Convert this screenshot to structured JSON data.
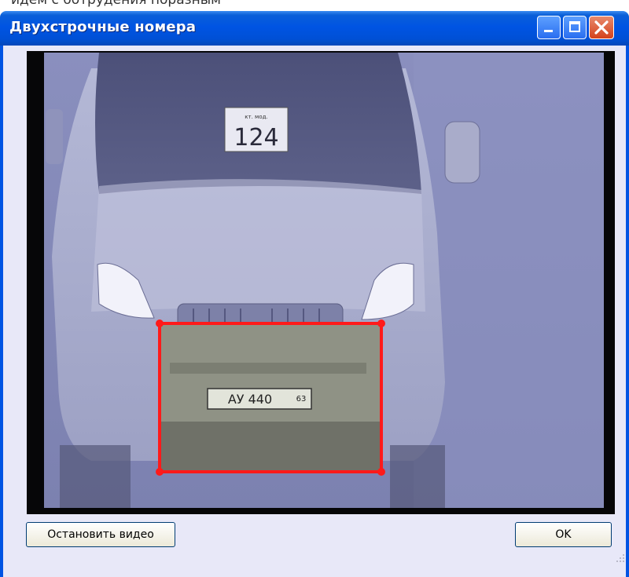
{
  "header_strip_text": "идем с ботрудения поразным",
  "window": {
    "title": "Двухстрочные номера",
    "minimize_label": "Minimize",
    "maximize_label": "Maximize",
    "close_label": "Close"
  },
  "video": {
    "sign_small_text": "кт. мод.",
    "sign_number": "124",
    "plate_text": "АУ 440",
    "plate_region": "63",
    "roi_color": "#ff1a1a"
  },
  "buttons": {
    "stop_video": "Остановить видео",
    "ok": "OK"
  },
  "colors": {
    "title_bar": "#0054e3",
    "client_bg": "#e8e8f8",
    "close_button": "#d4421c"
  }
}
